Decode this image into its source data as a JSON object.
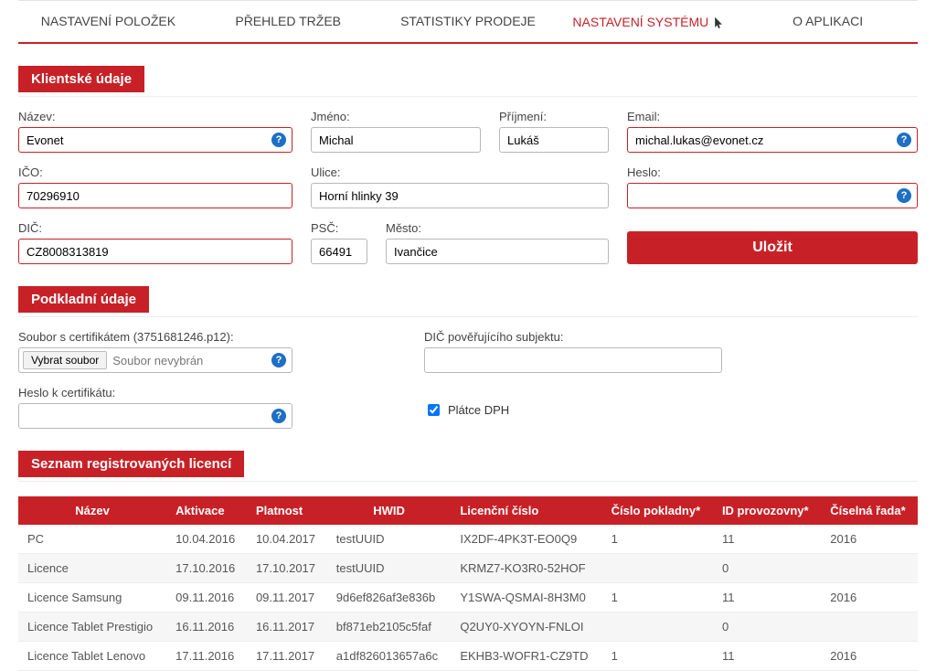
{
  "tabs": [
    {
      "label": "NASTAVENÍ POLOŽEK",
      "active": false
    },
    {
      "label": "PŘEHLED TRŽEB",
      "active": false
    },
    {
      "label": "STATISTIKY PRODEJE",
      "active": false
    },
    {
      "label": "NASTAVENÍ SYSTÉMU",
      "active": true
    },
    {
      "label": "O APLIKACI",
      "active": false
    }
  ],
  "sections": {
    "client": "Klientské údaje",
    "background": "Podkladní údaje",
    "licenses": "Seznam registrovaných licencí"
  },
  "labels": {
    "nazev": "Název:",
    "jmeno": "Jméno:",
    "prijmeni": "Příjmení:",
    "email": "Email:",
    "ico": "IČO:",
    "ulice": "Ulice:",
    "heslo": "Heslo:",
    "dic": "DIČ:",
    "psc": "PSČ:",
    "mesto": "Město:",
    "cert_file": "Soubor s certifikátem (3751681246.p12):",
    "cert_pass": "Heslo k certifikátu:",
    "dic_pover": "DIČ pověřujícího subjektu:",
    "vybrat": "Vybrat soubor",
    "nevybran": "Soubor nevybrán",
    "platce_dph": "Plátce DPH",
    "save": "Uložit"
  },
  "values": {
    "nazev": "Evonet",
    "jmeno": "Michal",
    "prijmeni": "Lukáš",
    "email": "michal.lukas@evonet.cz",
    "ico": "70296910",
    "ulice": "Horní hlinky 39",
    "heslo": "",
    "dic": "CZ8008313819",
    "psc": "66491",
    "mesto": "Ivančice",
    "cert_pass": "",
    "dic_pover": "",
    "platce_dph_checked": true
  },
  "license_table": {
    "headers": [
      "Název",
      "Aktivace",
      "Platnost",
      "HWID",
      "Licenční číslo",
      "Číslo pokladny*",
      "ID provozovny*",
      "Číselná řada*"
    ],
    "rows": [
      [
        "PC",
        "10.04.2016",
        "10.04.2017",
        "testUUID",
        "IX2DF-4PK3T-EO0Q9",
        "1",
        "11",
        "2016"
      ],
      [
        "Licence",
        "17.10.2016",
        "17.10.2017",
        "testUUID",
        "KRMZ7-KO3R0-52HOF",
        "",
        "0",
        ""
      ],
      [
        "Licence Samsung",
        "09.11.2016",
        "09.11.2017",
        "9d6ef826af3e836b",
        "Y1SWA-QSMAI-8H3M0",
        "1",
        "11",
        "2016"
      ],
      [
        "Licence Tablet Prestigio",
        "16.11.2016",
        "16.11.2017",
        "bf871eb2105c5faf",
        "Q2UY0-XYOYN-FNLOI",
        "",
        "0",
        ""
      ],
      [
        "Licence Tablet Lenovo",
        "17.11.2016",
        "17.11.2017",
        "a1df826013657a6c",
        "EKHB3-WOFR1-CZ9TD",
        "1",
        "11",
        "2016"
      ]
    ]
  }
}
